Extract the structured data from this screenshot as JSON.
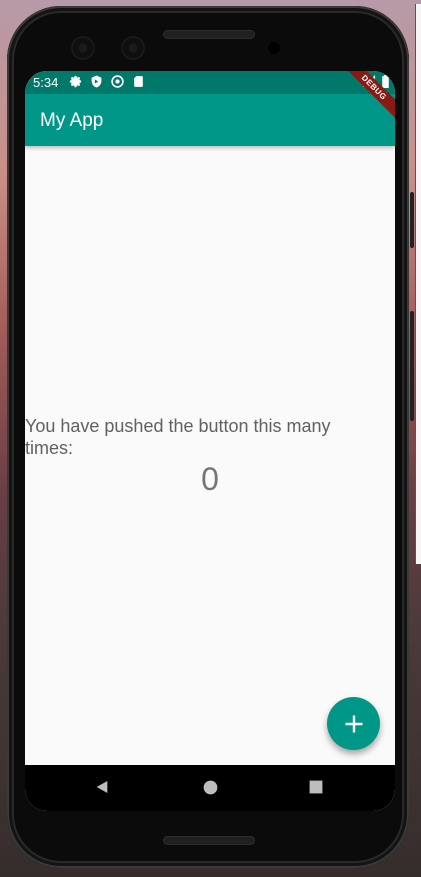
{
  "status_bar": {
    "time": "5:34",
    "left_icons": [
      "settings-icon",
      "shield-icon",
      "sync-icon",
      "sd-card-icon"
    ],
    "right_icons": [
      "signal-icon",
      "battery-icon"
    ]
  },
  "debug_banner": "DEBUG",
  "app_bar": {
    "title": "My App"
  },
  "body": {
    "counter_label": "You have pushed the button this many times:",
    "counter_value": "0"
  },
  "fab": {
    "icon": "add-icon"
  },
  "navigation": {
    "back_icon": "back-triangle-icon",
    "home_icon": "home-circle-icon",
    "recents_icon": "recents-square-icon"
  },
  "colors": {
    "primary": "#009688",
    "primary_dark": "#00796b",
    "background": "#fafafa",
    "text_secondary": "#616161"
  }
}
